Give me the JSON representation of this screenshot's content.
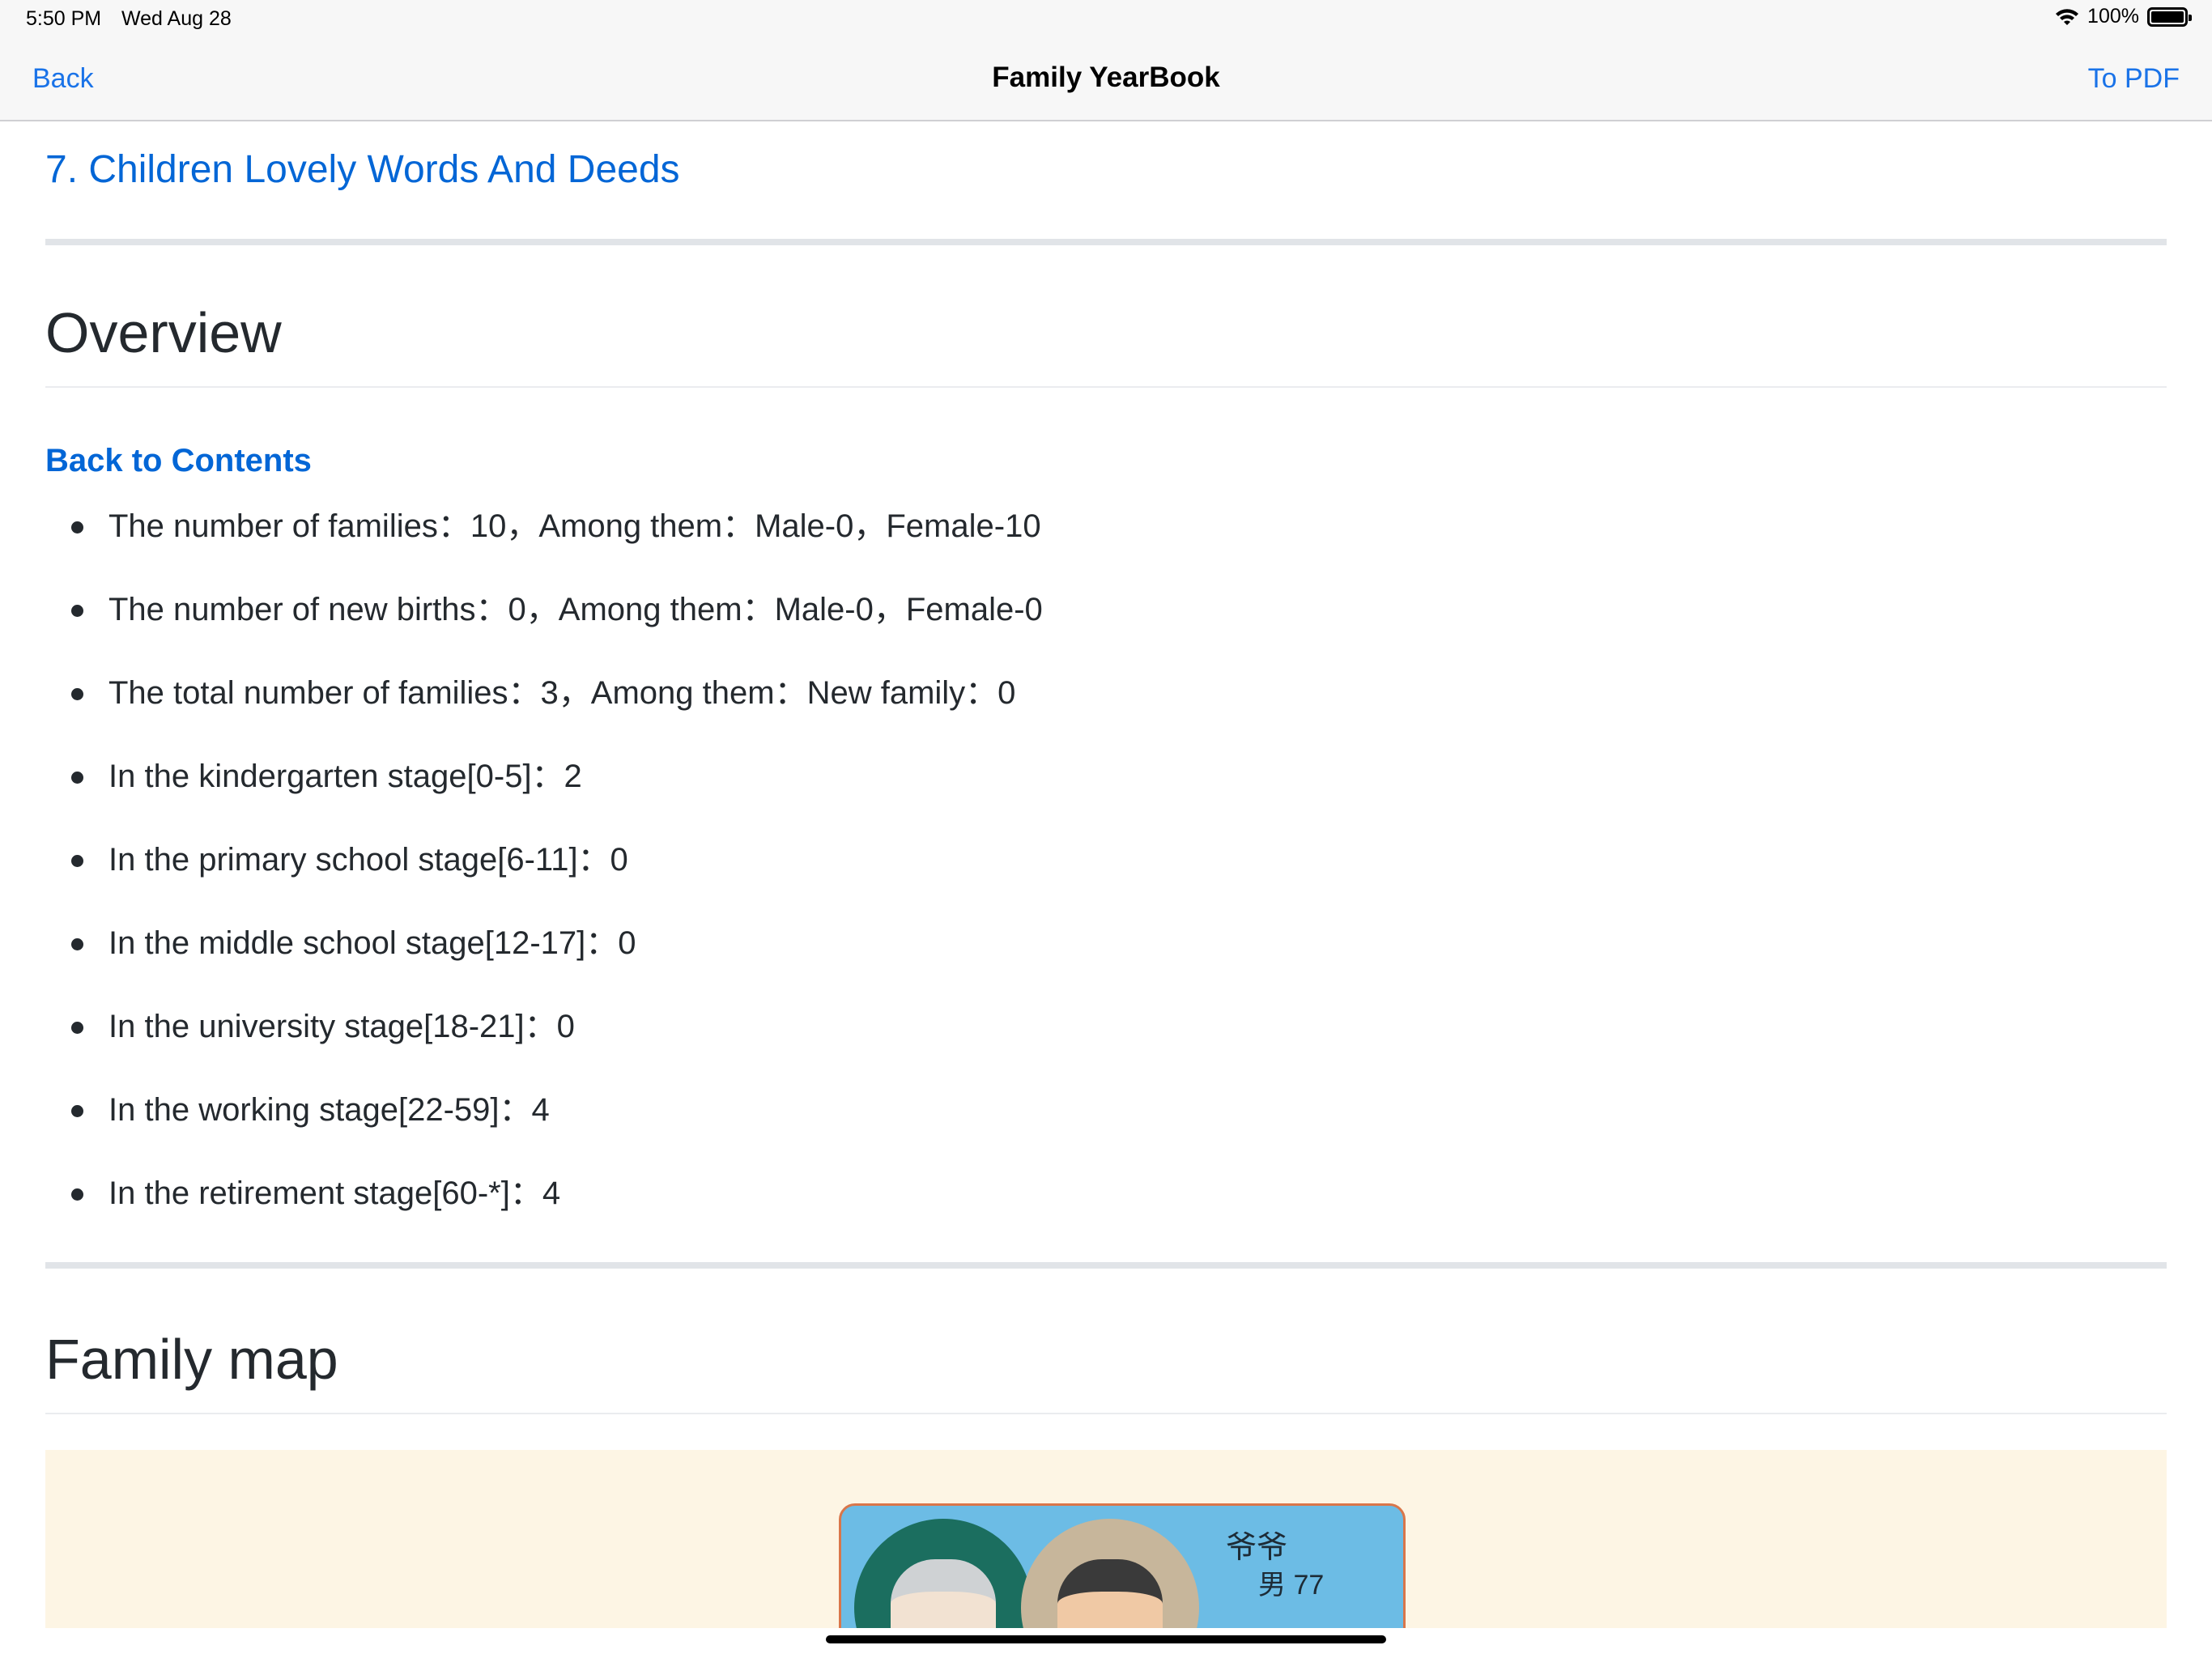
{
  "status": {
    "time": "5:50 PM",
    "date": "Wed Aug 28",
    "battery": "100%"
  },
  "nav": {
    "back": "Back",
    "title": "Family YearBook",
    "to_pdf": "To PDF"
  },
  "section_link": "7. Children Lovely Words And Deeds",
  "overview": {
    "heading": "Overview",
    "back_to_contents": "Back to Contents",
    "items": [
      "The number of families：10，Among them：Male-0，Female-10",
      "The number of new births：0，Among them：Male-0，Female-0",
      "The total number of families：3，Among them：New family：0",
      "In the kindergarten stage[0-5]：2",
      "In the primary school stage[6-11]：0",
      "In the middle school stage[12-17]：0",
      "In the university stage[18-21]：0",
      "In the working stage[22-59]：4",
      "In the retirement stage[60-*]：4"
    ]
  },
  "family_map": {
    "heading": "Family map",
    "card": {
      "name": "爷爷",
      "info": "男 77"
    }
  },
  "colors": {
    "link": "#0366d6",
    "nav_link": "#1a73e8",
    "map_bg": "#fdf5e4",
    "card_bg": "#6cbce5"
  }
}
